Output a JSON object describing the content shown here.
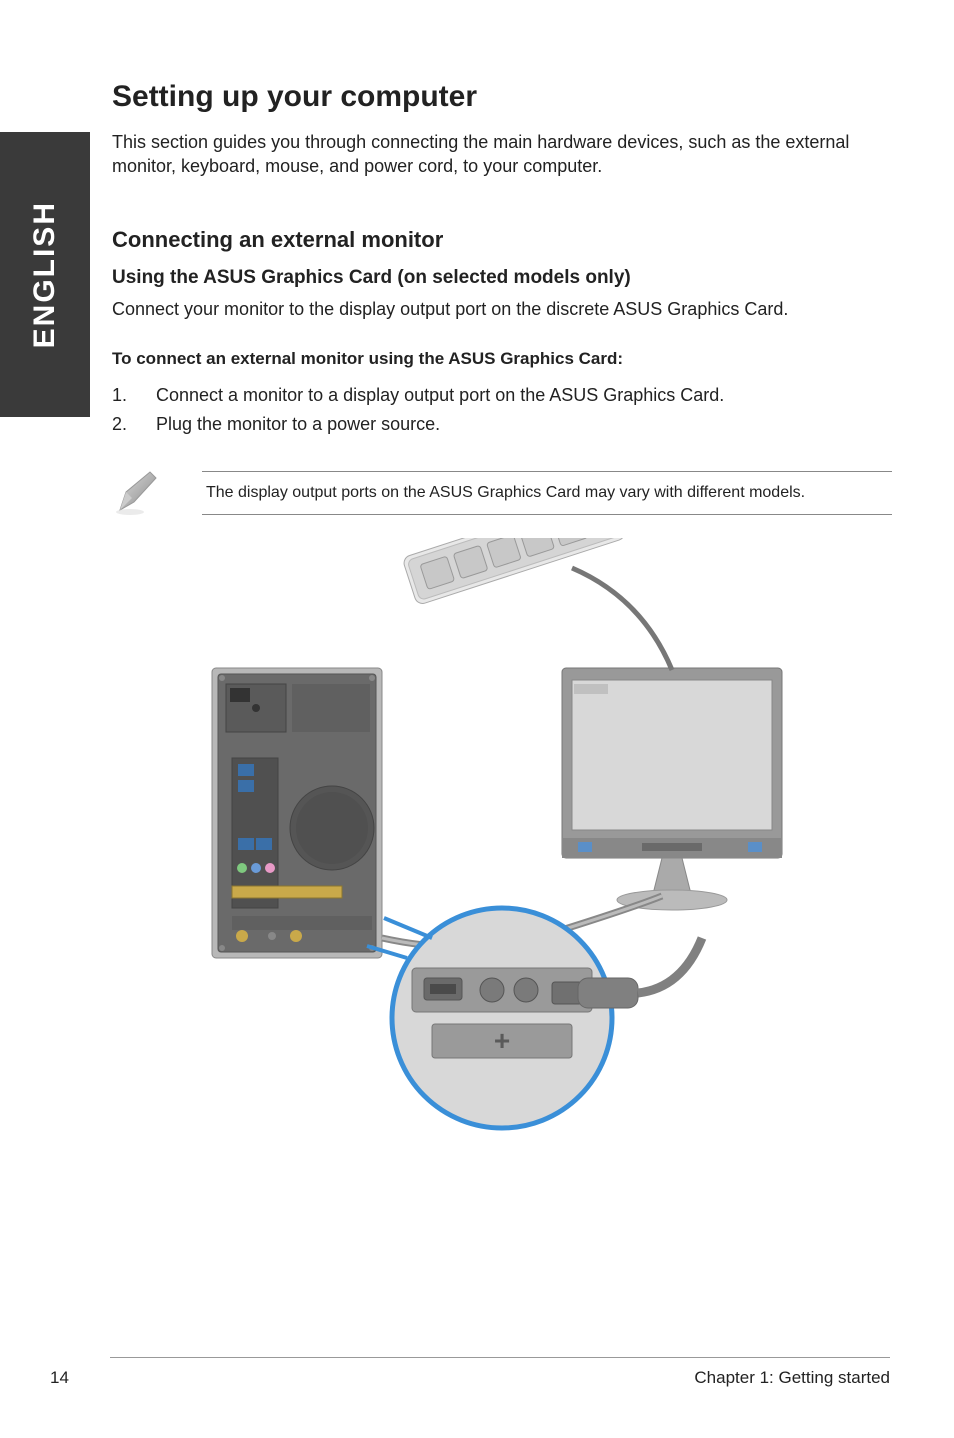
{
  "side_tab": "ENGLISH",
  "title": "Setting up your computer",
  "intro": "This section guides you through connecting the main hardware devices, such as the external monitor, keyboard, mouse, and power cord, to your computer.",
  "h2": "Connecting an external monitor",
  "h3": "Using the ASUS Graphics Card (on selected models only)",
  "sub_intro": "Connect your monitor to the display output port on the discrete ASUS Graphics Card.",
  "procedure_title": "To connect an external monitor using the ASUS Graphics Card:",
  "steps": [
    {
      "num": "1.",
      "text": "Connect a monitor to a display output port on the ASUS Graphics Card."
    },
    {
      "num": "2.",
      "text": "Plug the monitor to a power source."
    }
  ],
  "note": "The display output ports on the ASUS Graphics Card may vary with different models.",
  "footer": {
    "page": "14",
    "chapter": "Chapter 1: Getting started"
  }
}
